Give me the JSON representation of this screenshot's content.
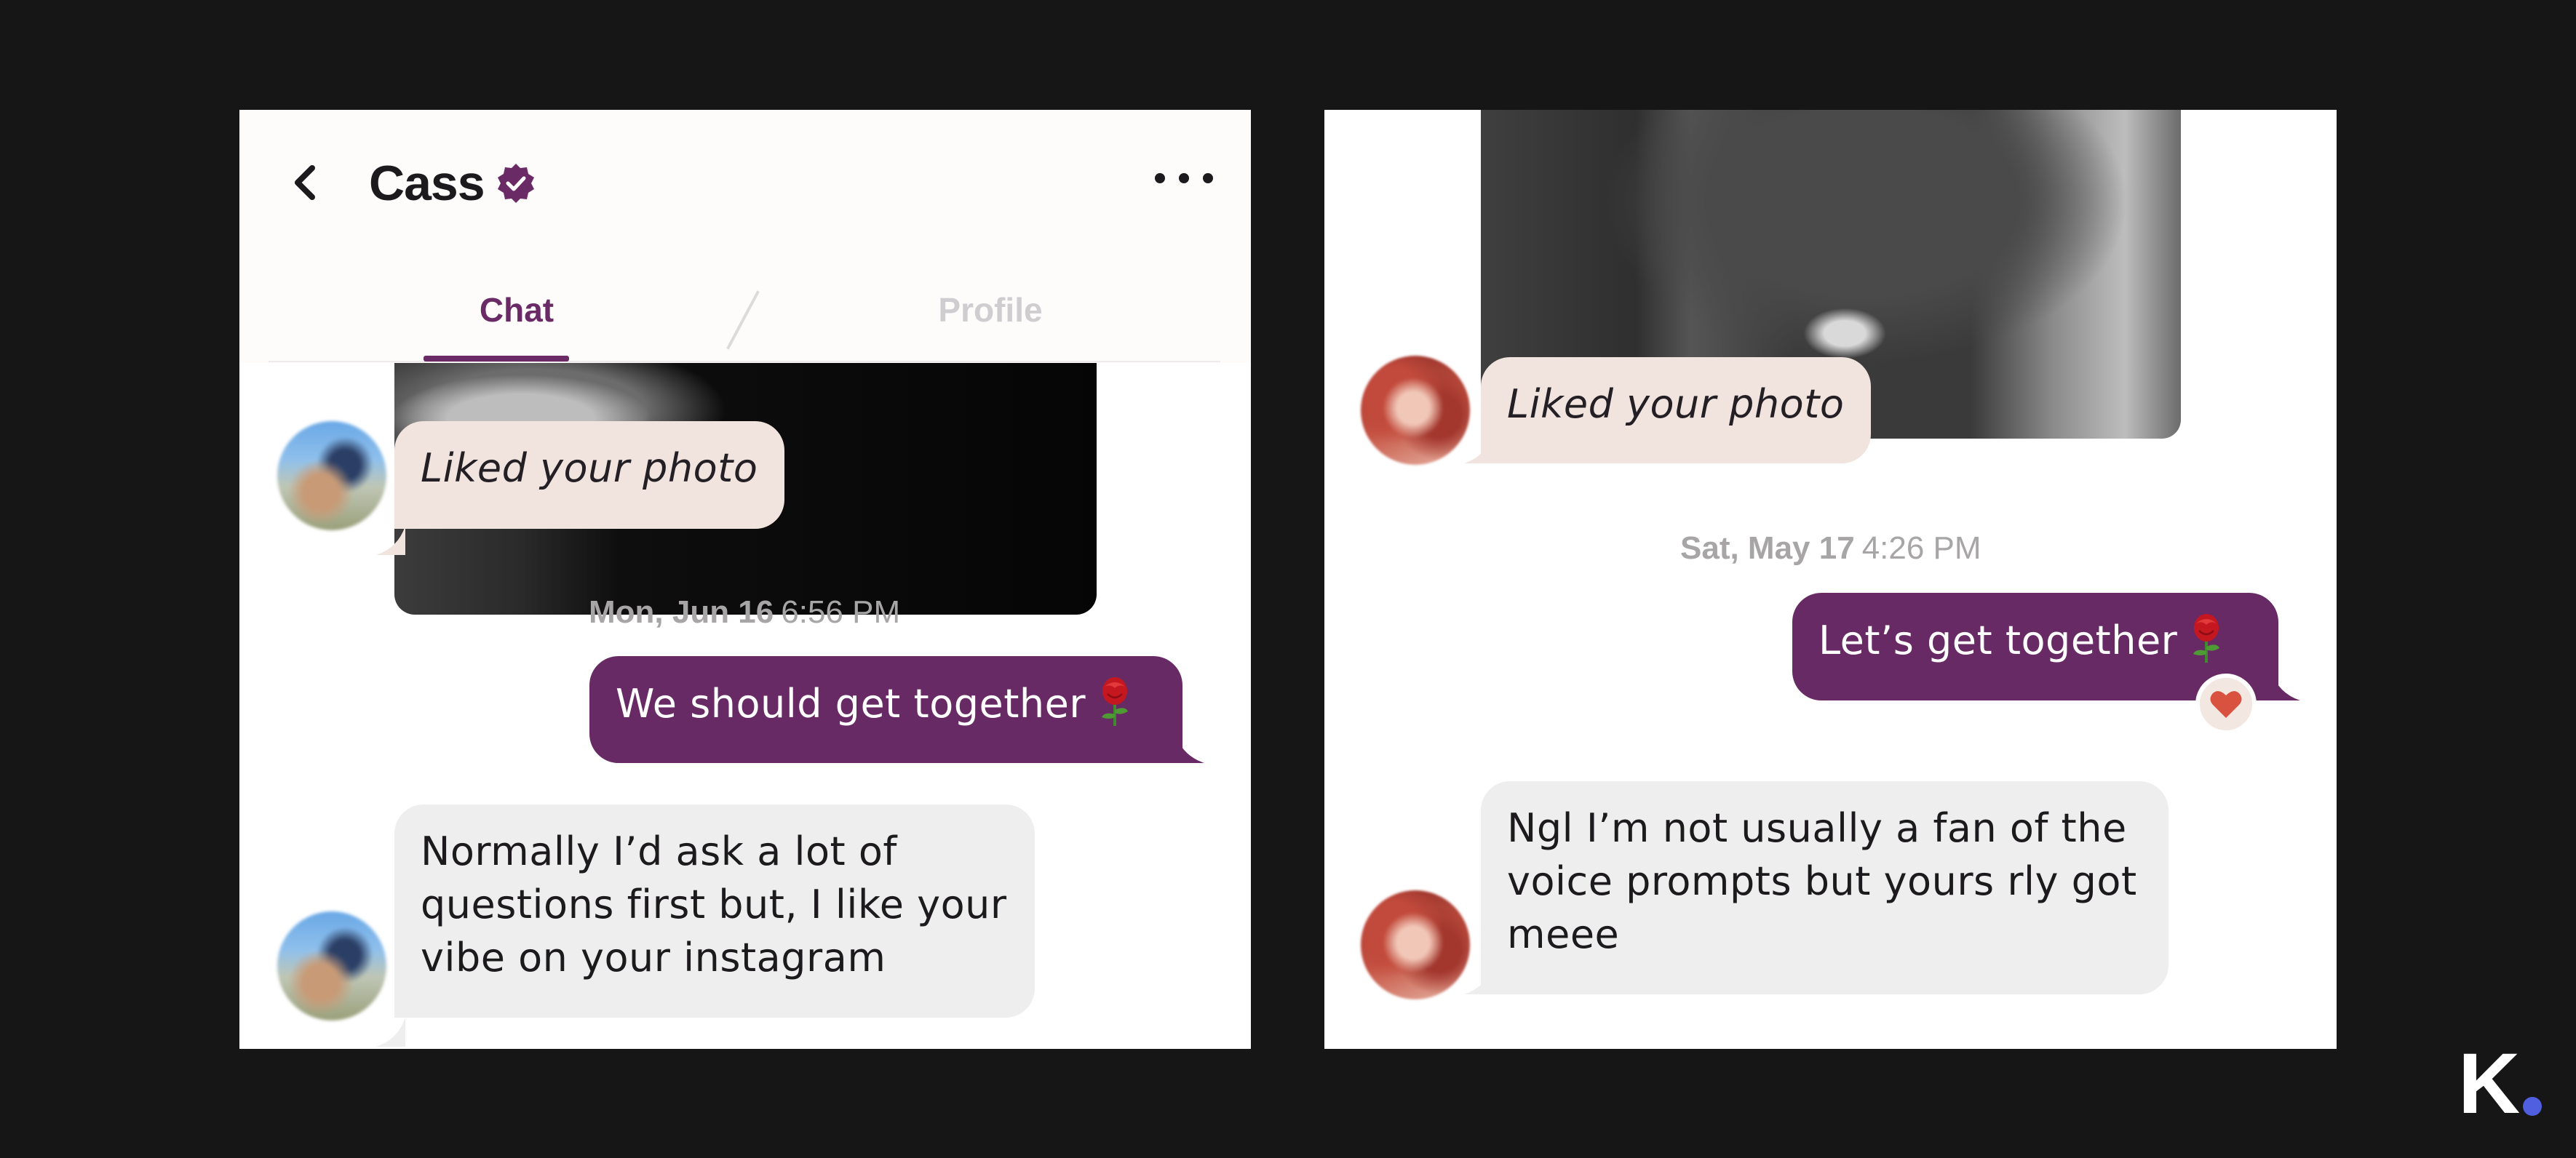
{
  "left_screen": {
    "header": {
      "contact_name": "Cass",
      "verified_icon": "verified-badge-icon",
      "back_icon": "chevron-left-icon",
      "more_icon": "more-horizontal-icon"
    },
    "tabs": [
      {
        "label": "Chat",
        "active": true
      },
      {
        "label": "Profile",
        "active": false
      }
    ],
    "messages": [
      {
        "type": "like",
        "text": "Liked your photo"
      },
      {
        "type": "timestamp",
        "date": "Mon, Jun 16",
        "time": "6:56 PM"
      },
      {
        "type": "sent",
        "text": "We should get together"
      },
      {
        "type": "received",
        "lines": [
          "Normally I’d ask a lot of",
          "questions first but, I like your",
          "vibe on your instagram"
        ]
      }
    ]
  },
  "right_screen": {
    "messages": [
      {
        "type": "like",
        "text": "Liked your photo"
      },
      {
        "type": "timestamp",
        "date": "Sat, May 17",
        "time": "4:26 PM"
      },
      {
        "type": "sent",
        "text": "Let’s get together",
        "reaction_icon": "heart-icon"
      },
      {
        "type": "received",
        "lines": [
          "Ngl I’m not usually a fan of the",
          "voice prompts but yours rly got",
          "meee"
        ]
      }
    ]
  },
  "colors": {
    "background": "#161616",
    "accent_purple": "#682a64",
    "like_bubble": "#f1e4df",
    "received_bubble": "#eeeeee",
    "timestamp_text": "#a7a5a6",
    "heart": "#d9513f",
    "brand_dot": "#4f5fe0"
  },
  "brand": {
    "letter": "K",
    "icon": "brand-logo-icon"
  }
}
